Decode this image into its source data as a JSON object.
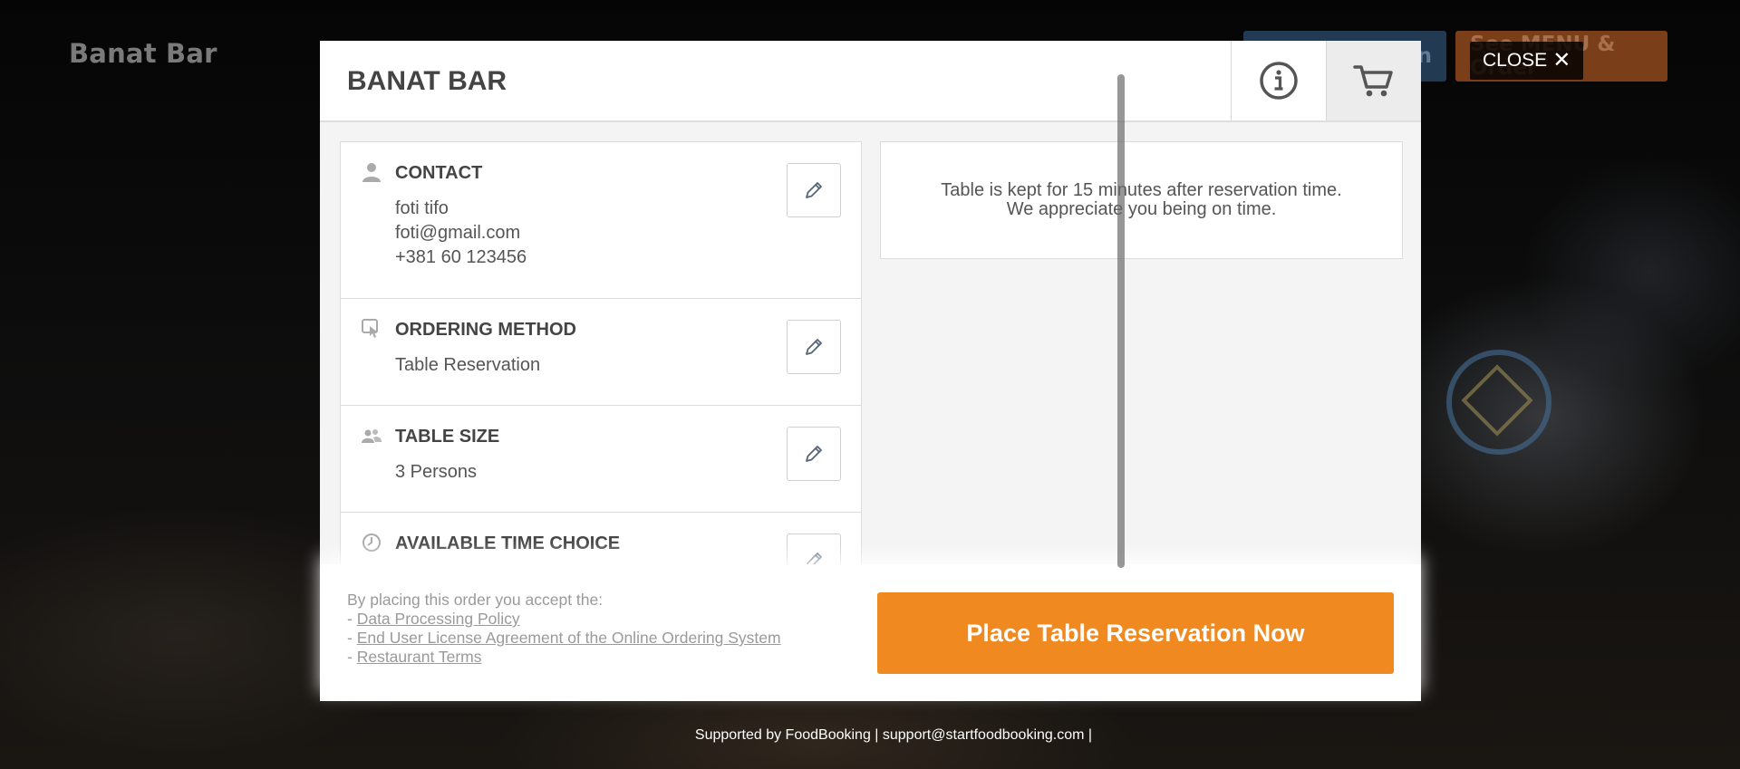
{
  "page": {
    "brand": "Banat Bar",
    "top_buttons": {
      "left_partial_label": "n",
      "right_partial_label": "See MENU & Order"
    },
    "close_label": "CLOSE",
    "close_glyph": "✕",
    "support_text": "Supported by FoodBooking | support@startfoodbooking.com |"
  },
  "modal": {
    "title": "BANAT BAR",
    "header_icons": [
      "info-icon",
      "cart-icon"
    ],
    "sections": {
      "contact": {
        "title": "CONTACT",
        "icon": "person-icon",
        "lines": [
          "foti tifo",
          "foti@gmail.com",
          "+381 60 123456"
        ]
      },
      "ordering_method": {
        "title": "ORDERING METHOD",
        "icon": "tap-icon",
        "value": "Table Reservation"
      },
      "table_size": {
        "title": "TABLE SIZE",
        "icon": "people-icon",
        "value": "3 Persons"
      },
      "time_choice": {
        "title": "AVAILABLE TIME CHOICE",
        "icon": "clock-icon"
      }
    },
    "notice": {
      "line1": "Table is kept for 15 minutes after reservation time.",
      "line2": "We appreciate you being on time."
    },
    "terms": {
      "intro": "By placing this order you accept the:",
      "prefix": "- ",
      "links": [
        "Data Processing Policy",
        "End User License Agreement of the Online Ordering System",
        "Restaurant Terms"
      ]
    },
    "place_button": "Place Table Reservation Now"
  },
  "colors": {
    "accent": "#f0891f",
    "title_text": "#444444",
    "body_text": "#555555"
  }
}
